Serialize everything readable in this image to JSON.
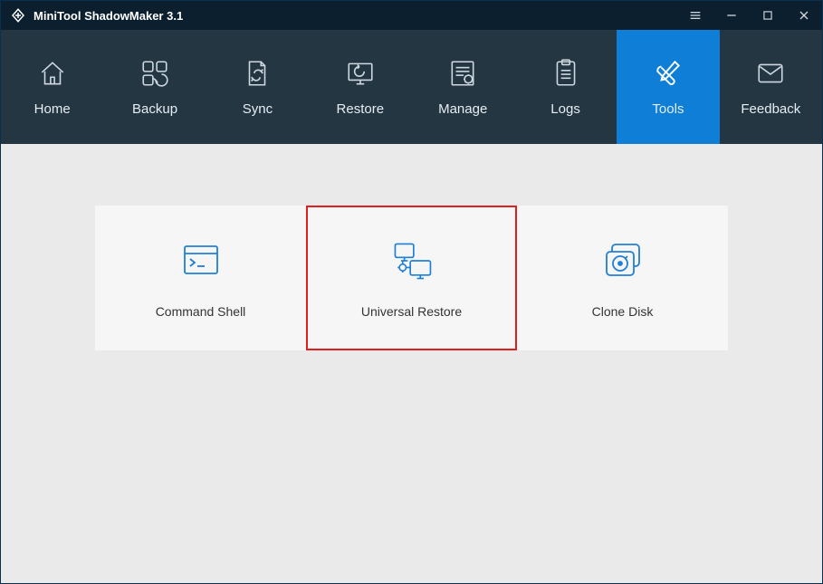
{
  "app": {
    "title": "MiniTool ShadowMaker 3.1"
  },
  "nav": {
    "items": [
      {
        "label": "Home",
        "active": false
      },
      {
        "label": "Backup",
        "active": false
      },
      {
        "label": "Sync",
        "active": false
      },
      {
        "label": "Restore",
        "active": false
      },
      {
        "label": "Manage",
        "active": false
      },
      {
        "label": "Logs",
        "active": false
      },
      {
        "label": "Tools",
        "active": true
      },
      {
        "label": "Feedback",
        "active": false
      }
    ]
  },
  "tools": {
    "cards": [
      {
        "label": "Command Shell",
        "highlighted": false
      },
      {
        "label": "Universal Restore",
        "highlighted": true
      },
      {
        "label": "Clone Disk",
        "highlighted": false
      }
    ]
  }
}
